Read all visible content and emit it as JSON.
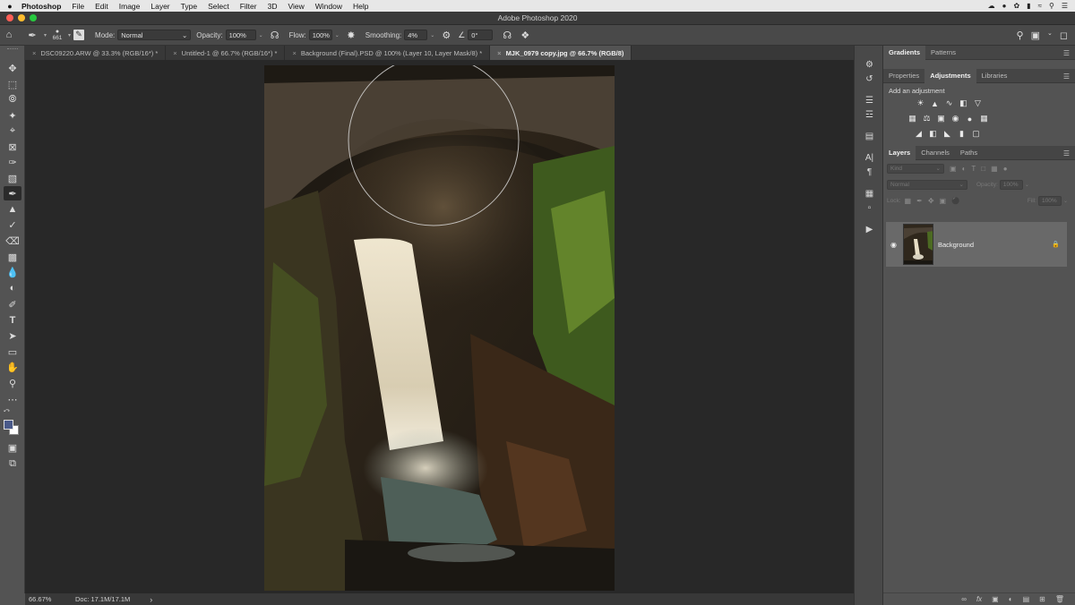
{
  "menubar": {
    "apple": "",
    "items": [
      "Photoshop",
      "File",
      "Edit",
      "Image",
      "Layer",
      "Type",
      "Select",
      "Filter",
      "3D",
      "View",
      "Window",
      "Help"
    ]
  },
  "window": {
    "title": "Adobe Photoshop 2020"
  },
  "options": {
    "brush_size": "661",
    "mode_label": "Mode:",
    "mode_value": "Normal",
    "opacity_label": "Opacity:",
    "opacity_value": "100%",
    "flow_label": "Flow:",
    "flow_value": "100%",
    "smoothing_label": "Smoothing:",
    "smoothing_value": "4%",
    "angle_value": "0°"
  },
  "tabs": [
    {
      "label": "DSC09220.ARW @ 33.3% (RGB/16*) *"
    },
    {
      "label": "Untitled-1 @ 66.7% (RGB/16*) *"
    },
    {
      "label": "Background (Final).PSD @ 100% (Layer 10, Layer Mask/8) *"
    },
    {
      "label": "MJK_0979 copy.jpg @ 66.7% (RGB/8)"
    }
  ],
  "status": {
    "zoom": "66.67%",
    "doc": "Doc: 17.1M/17.1M",
    "arrow": "›"
  },
  "panels": {
    "top_tabs": [
      "Gradients",
      "Patterns"
    ],
    "mid_tabs": [
      "Properties",
      "Adjustments",
      "Libraries"
    ],
    "adj_title": "Add an adjustment",
    "layer_tabs": [
      "Layers",
      "Channels",
      "Paths"
    ],
    "kind_placeholder": "Kind",
    "blend_mode": "Normal",
    "opacity_label": "Opacity:",
    "opacity_value": "100%",
    "lock_label": "Lock:",
    "fill_label": "Fill:",
    "fill_value": "100%",
    "layer_name": "Background"
  },
  "colors": {
    "foreground": "#4a5a8a",
    "background": "#ffffff",
    "traffic_close": "#ff5f56",
    "traffic_min": "#ffbd2e",
    "traffic_max": "#27c93f"
  }
}
